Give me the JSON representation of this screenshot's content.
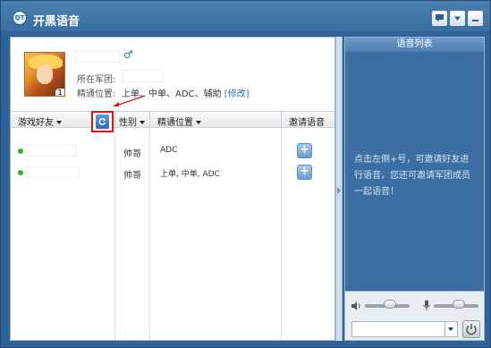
{
  "window": {
    "title": "开黑语音",
    "icon": "qt-logo-icon"
  },
  "profile": {
    "avatar_level": "1",
    "army_label": "所在军团:",
    "positions_label": "精通位置:",
    "positions_value": "上单、中单、ADC、辅助",
    "edit_label": "[修改]"
  },
  "friends_list": {
    "columns": {
      "friends": "游戏好友",
      "gender": "性别",
      "position": "精通位置",
      "invite": "邀请语音"
    },
    "rows": [
      {
        "gender": "帅哥",
        "position": "ADC",
        "online": true
      },
      {
        "gender": "帅哥",
        "position": "上单, 中单, ADC",
        "online": true
      }
    ]
  },
  "voice_panel": {
    "title": "语音列表",
    "message": "点击左侧+号，可邀请好友进行语音，您还可邀请军团成员一起语音！",
    "speaker_volume": 0.55,
    "mic_volume": 0.55
  },
  "colors": {
    "accent": "#2f6397",
    "highlight": "#e01010",
    "online": "#38b12e"
  }
}
